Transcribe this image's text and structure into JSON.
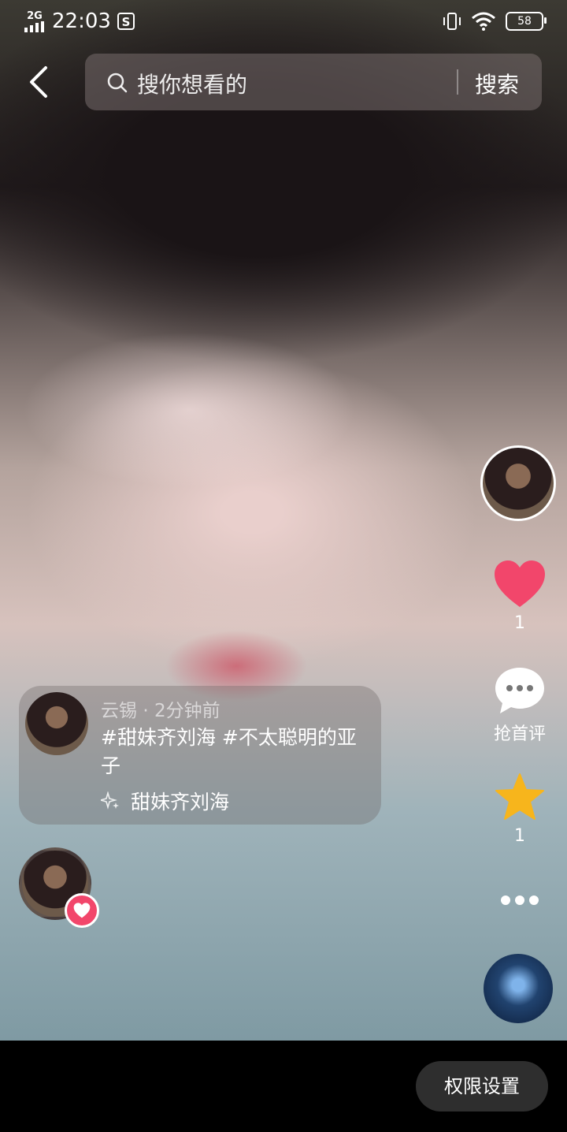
{
  "status_bar": {
    "network": "2G",
    "time": "22:03",
    "battery": "58"
  },
  "search": {
    "placeholder": "搜你想看的",
    "button": "搜索"
  },
  "actions": {
    "like_count": "1",
    "comment_label": "抢首评",
    "favorite_count": "1"
  },
  "post": {
    "author": "云锡",
    "time_ago": "2分钟前",
    "caption": "#甜妹齐刘海 #不太聪明的亚子",
    "topic": "甜妹齐刘海"
  },
  "bottom": {
    "permission_button": "权限设置"
  },
  "colors": {
    "like": "#f2466b",
    "favorite": "#f7b51c",
    "heart_badge": "#f2466b"
  }
}
